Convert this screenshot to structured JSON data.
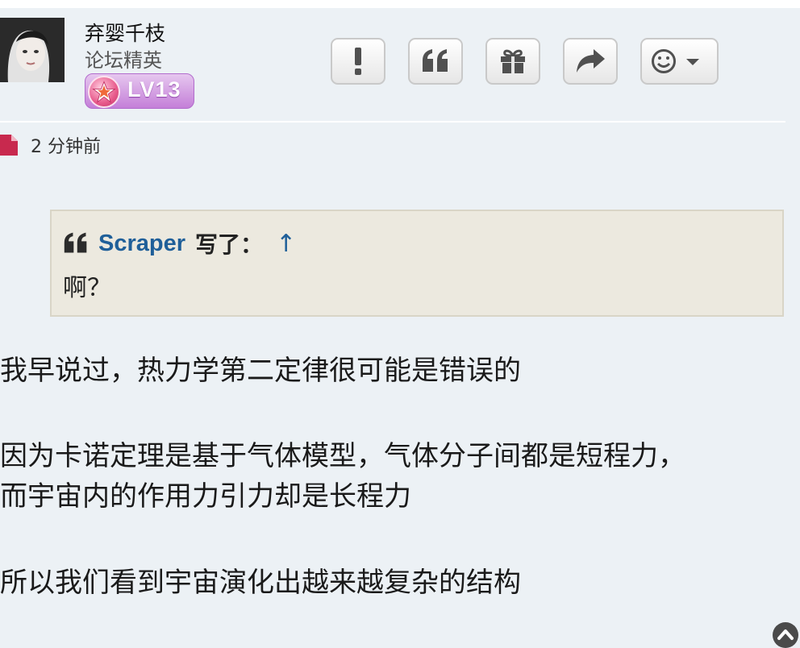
{
  "user": {
    "name": "弃婴千枝",
    "rank": "论坛精英",
    "level_badge": "LV13"
  },
  "actions": {
    "report_icon": "exclamation-icon",
    "quote_icon": "quote-icon",
    "gift_icon": "gift-icon",
    "share_icon": "share-arrow-icon",
    "emoji_icon": "smiley-dropdown-icon"
  },
  "post": {
    "time": "2 分钟前",
    "quote": {
      "author": "Scraper",
      "wrote": "写了：",
      "up_arrow": "↑",
      "text": "啊？"
    },
    "paragraphs": [
      "我早说过，热力学第二定律很可能是错误的",
      "因为卡诺定理是基于气体模型，气体分子间都是短程力，",
      "而宇宙内的作用力引力却是长程力",
      "所以我们看到宇宙演化出越来越复杂的结构"
    ]
  },
  "colors": {
    "background": "#ecf1f5",
    "link": "#1f5f99",
    "badge": "#c47fd8",
    "quote_bg": "#ece9df"
  }
}
